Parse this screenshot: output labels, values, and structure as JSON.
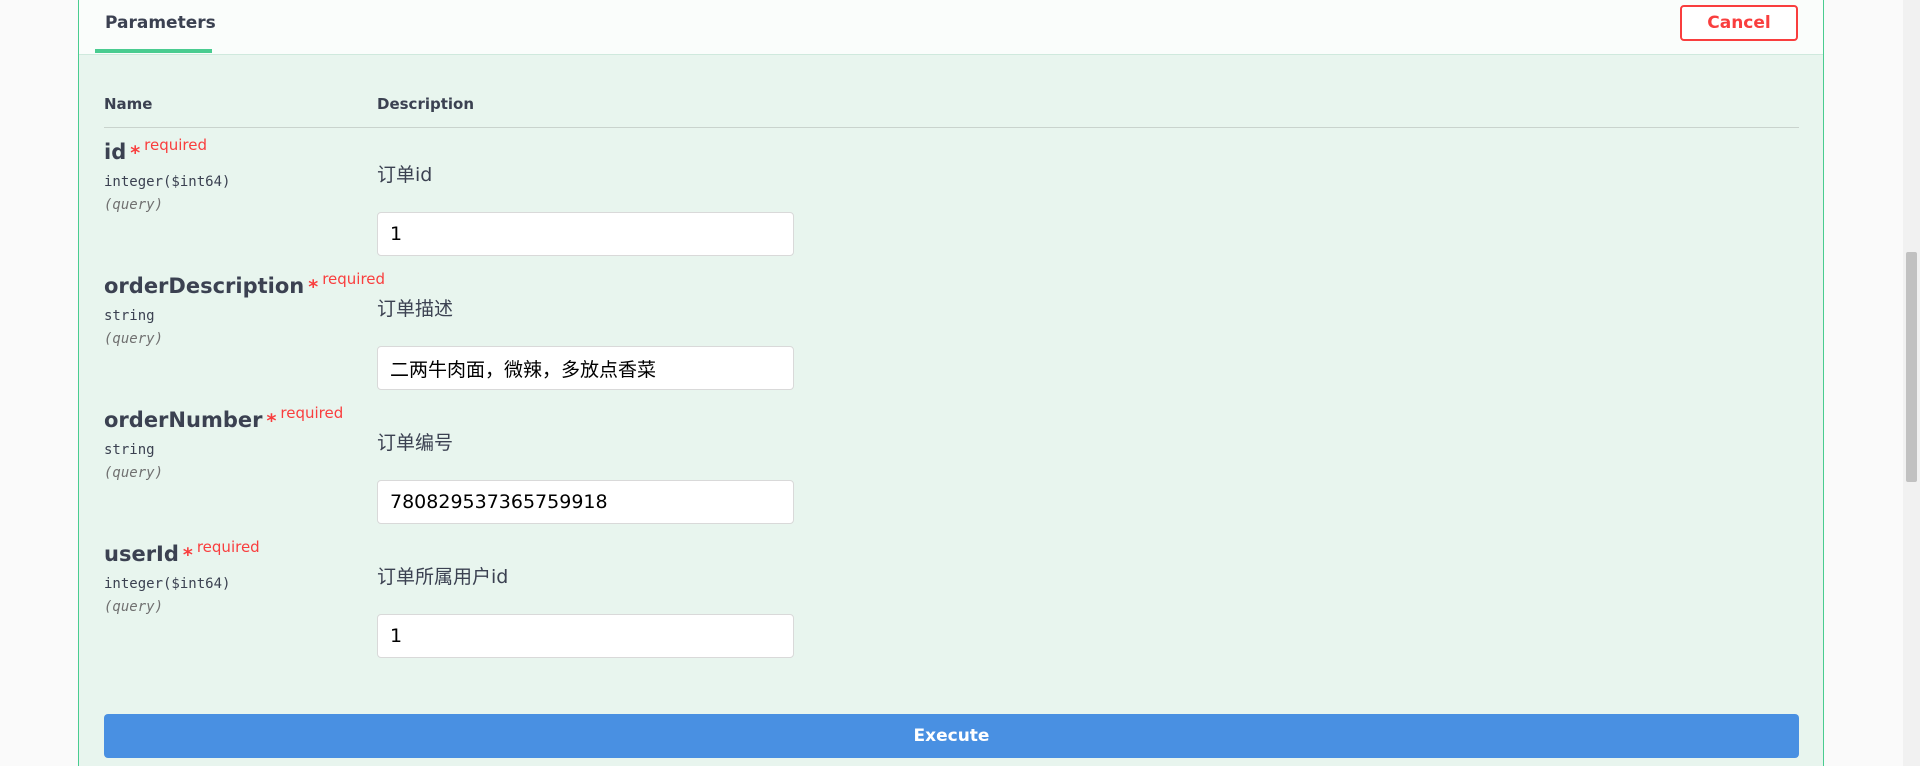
{
  "header": {
    "tab_label": "Parameters",
    "cancel_label": "Cancel"
  },
  "columns": {
    "name": "Name",
    "description": "Description"
  },
  "required_label": "required",
  "required_star": "*",
  "parameters": [
    {
      "name": "id",
      "type": "integer($int64)",
      "in": "(query)",
      "description": "订单id",
      "value": "1"
    },
    {
      "name": "orderDescription",
      "type": "string",
      "in": "(query)",
      "description": "订单描述",
      "value": "二两牛肉面，微辣，多放点香菜"
    },
    {
      "name": "orderNumber",
      "type": "string",
      "in": "(query)",
      "description": "订单编号",
      "value": "780829537365759918"
    },
    {
      "name": "userId",
      "type": "integer($int64)",
      "in": "(query)",
      "description": "订单所属用户id",
      "value": "1"
    }
  ],
  "execute_label": "Execute",
  "colors": {
    "accent_green": "#49cc90",
    "panel_bg": "#e8f5ee",
    "danger": "#f93e3e",
    "execute_blue": "#4990e2"
  }
}
